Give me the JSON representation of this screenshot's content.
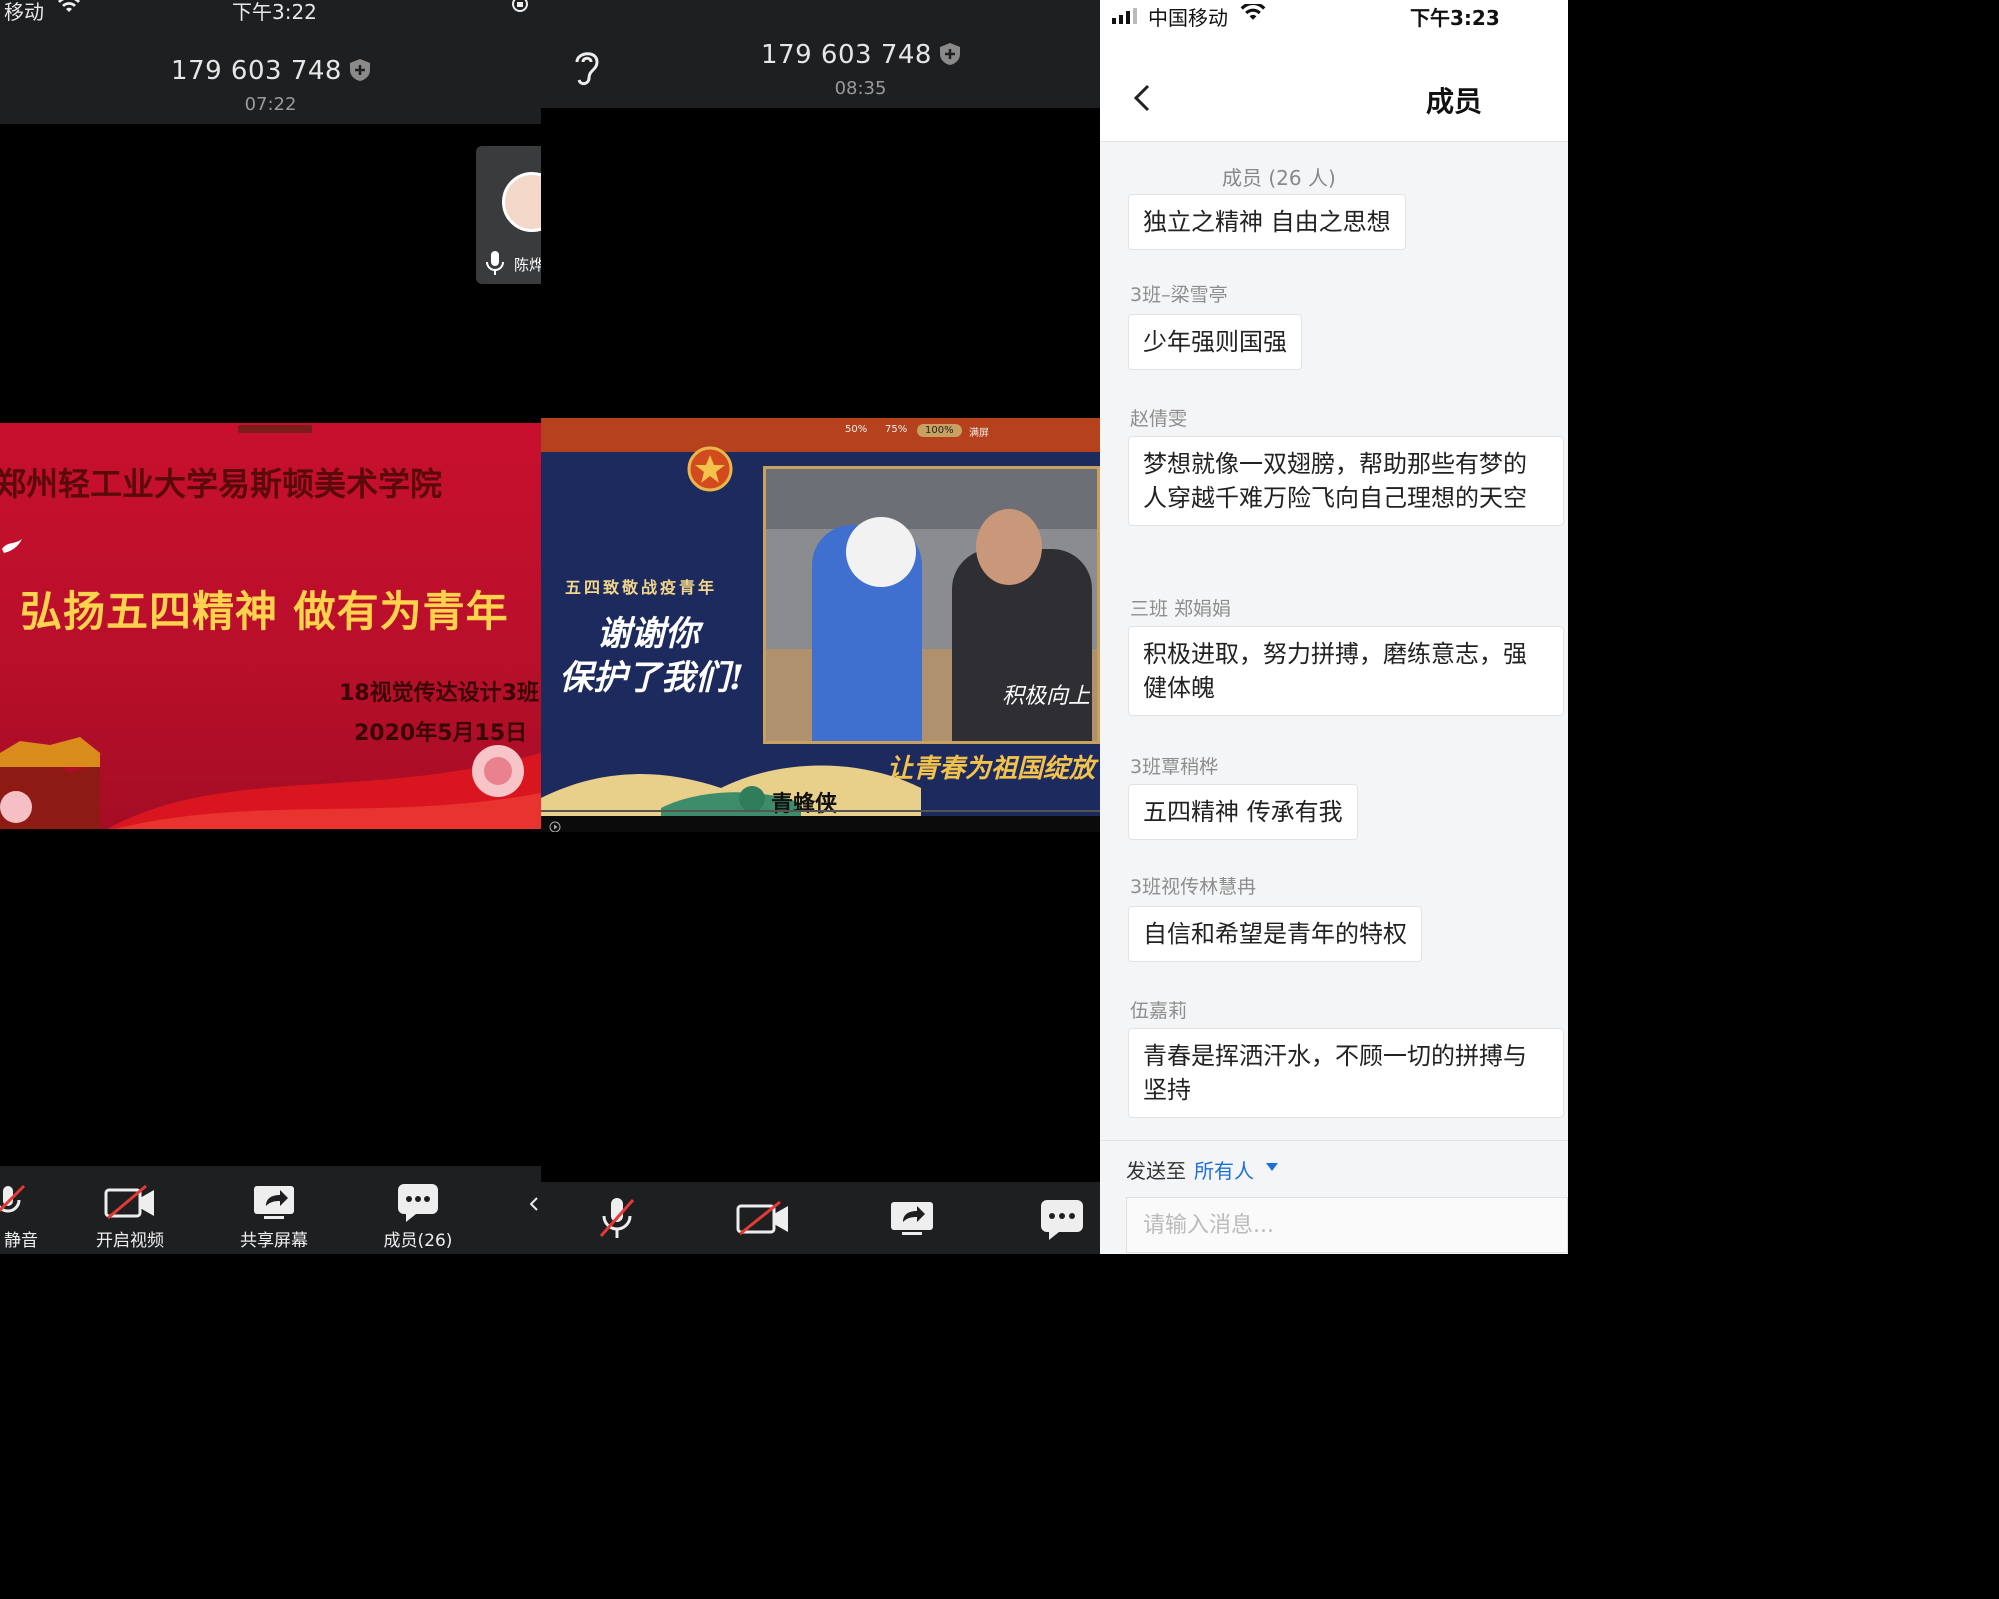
{
  "panel1": {
    "status": {
      "carrier": "移动",
      "time": "下午3:22"
    },
    "meeting_id": "179 603 748",
    "duration": "07:22",
    "thumb_name": "陈烨",
    "slide": {
      "school": "郑州轻工业大学易斯顿美术学院",
      "headline": "弘扬五四精神 做有为青年",
      "class": "18视觉传达设计3班",
      "date": "2020年5月15日"
    },
    "toolbar": {
      "mute_label": "静音",
      "video_label": "开启视频",
      "share_label": "共享屏幕",
      "members_label": "成员(26)"
    }
  },
  "panel2": {
    "meeting_id": "179 603 748",
    "duration": "08:35",
    "video": {
      "zoom": [
        "50%",
        "75%",
        "100%",
        "满屏"
      ],
      "slogan_small": "五四致敬战疫青年",
      "slogan_line1": "谢谢你",
      "slogan_line2": "保护了我们!",
      "photo_caption": "积极向上",
      "bottom_slogan": "让青春为祖国绽放",
      "brand": "青蜂侠"
    }
  },
  "panel3": {
    "status": {
      "carrier": "中国移动",
      "time": "下午3:23"
    },
    "title": "成员",
    "member_count": "成员 (26 人)",
    "messages": [
      {
        "sender": "",
        "text": "独立之精神  自由之思想"
      },
      {
        "sender": "3班–梁雪亭",
        "text": "少年强则国强"
      },
      {
        "sender": "赵倩雯",
        "text": "梦想就像一双翅膀，帮助那些有梦的人穿越千难万险飞向自己理想的天空"
      },
      {
        "sender": "三班 郑娟娟",
        "text": "积极进取，努力拼搏，磨练意志，强健体魄"
      },
      {
        "sender": "3班覃稍桦",
        "text": "五四精神  传承有我"
      },
      {
        "sender": "3班视传林慧冉",
        "text": "自信和希望是青年的特权"
      },
      {
        "sender": "伍嘉莉",
        "text": "青春是挥洒汗水，不顾一切的拼搏与坚持"
      }
    ],
    "send_label": "发送至",
    "send_target": "所有人",
    "input_placeholder": "请输入消息..."
  },
  "colors": {
    "accent": "#1f6fd8",
    "toolbar_bg": "#1e1f21",
    "slide_red": "#c8102e",
    "headline_gold": "#ffd34d"
  }
}
